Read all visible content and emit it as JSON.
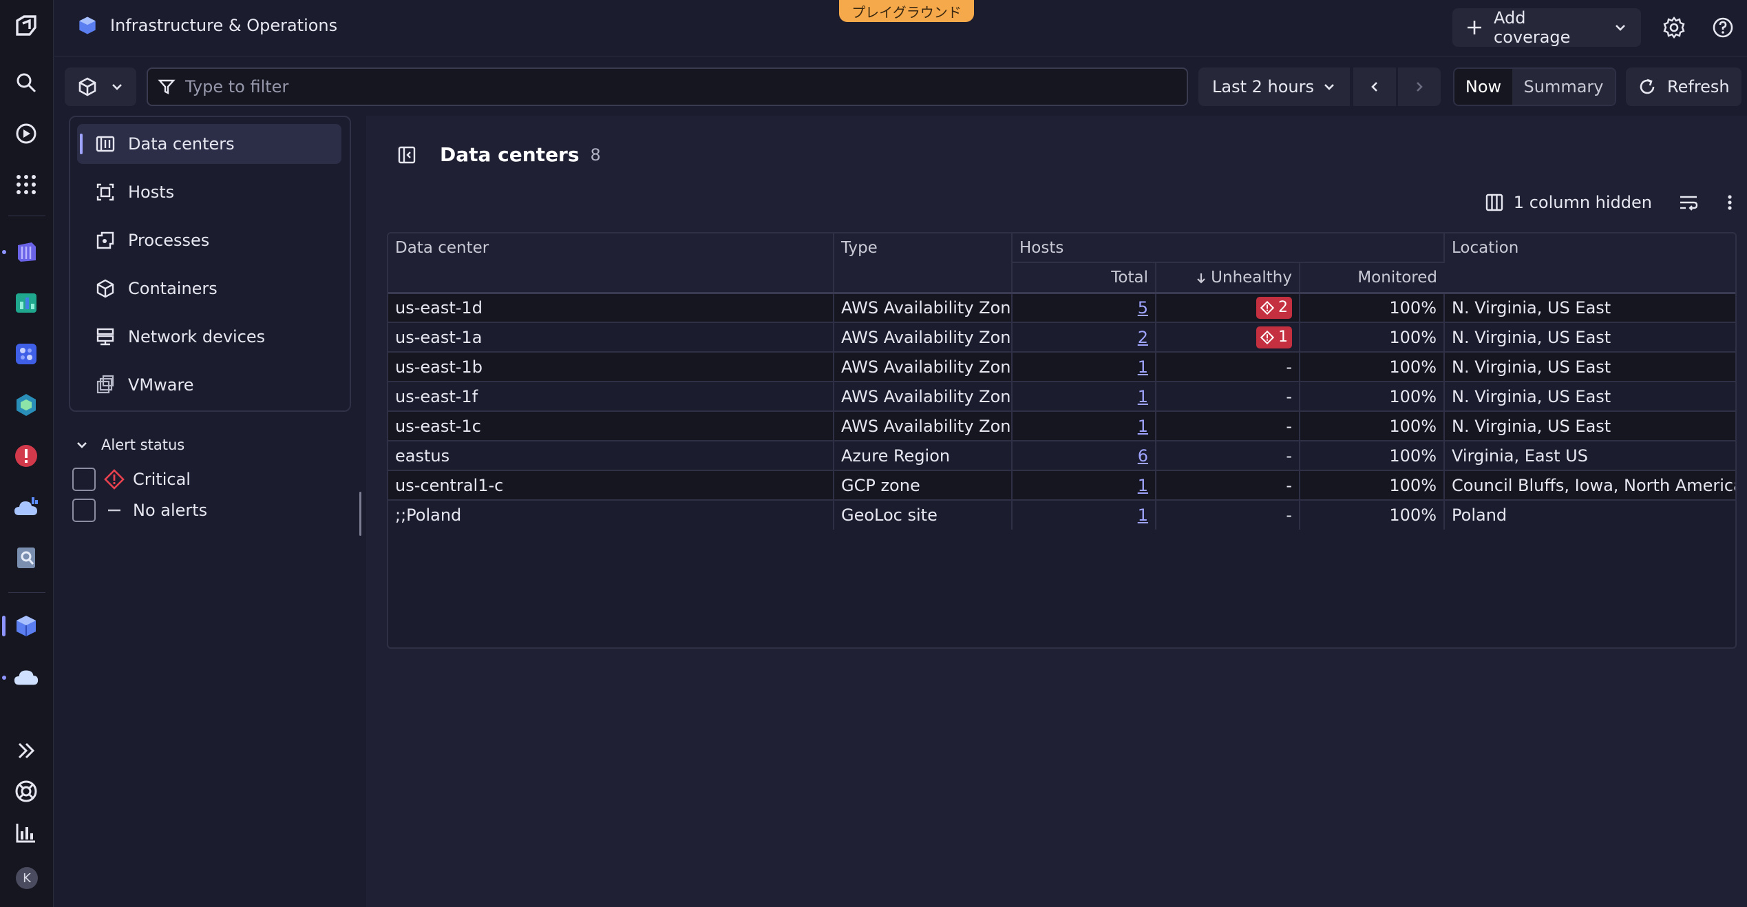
{
  "header": {
    "app_title": "Infrastructure & Operations",
    "playground_badge": "プレイグラウンド",
    "add_coverage_label": "Add coverage"
  },
  "toolbar": {
    "filter_placeholder": "Type to filter",
    "filter_value": "",
    "timeframe_label": "Last 2 hours",
    "now_label": "Now",
    "summary_label": "Summary",
    "refresh_label": "Refresh"
  },
  "nav": {
    "items": [
      {
        "label": "Data centers",
        "icon": "datacenter-icon",
        "active": true
      },
      {
        "label": "Hosts",
        "icon": "host-icon",
        "active": false
      },
      {
        "label": "Processes",
        "icon": "process-icon",
        "active": false
      },
      {
        "label": "Containers",
        "icon": "container-icon",
        "active": false
      },
      {
        "label": "Network devices",
        "icon": "network-device-icon",
        "active": false
      },
      {
        "label": "VMware",
        "icon": "vmware-icon",
        "active": false
      }
    ]
  },
  "alert_filter": {
    "heading": "Alert status",
    "options": [
      {
        "label": "Critical",
        "checked": false
      },
      {
        "label": "No alerts",
        "checked": false
      }
    ]
  },
  "main": {
    "title": "Data centers",
    "count": "8",
    "columns_hidden_label": "1 column hidden"
  },
  "table": {
    "headers": {
      "data_center": "Data center",
      "type": "Type",
      "hosts": "Hosts",
      "total": "Total",
      "unhealthy": "Unhealthy",
      "monitored": "Monitored",
      "location": "Location"
    },
    "rows": [
      {
        "data_center": "us-east-1d",
        "type": "AWS Availability Zone",
        "total": "5",
        "unhealthy": "2",
        "monitored": "100%",
        "location": "N. Virginia, US East"
      },
      {
        "data_center": "us-east-1a",
        "type": "AWS Availability Zone",
        "total": "2",
        "unhealthy": "1",
        "monitored": "100%",
        "location": "N. Virginia, US East"
      },
      {
        "data_center": "us-east-1b",
        "type": "AWS Availability Zone",
        "total": "1",
        "unhealthy": "-",
        "monitored": "100%",
        "location": "N. Virginia, US East"
      },
      {
        "data_center": "us-east-1f",
        "type": "AWS Availability Zone",
        "total": "1",
        "unhealthy": "-",
        "monitored": "100%",
        "location": "N. Virginia, US East"
      },
      {
        "data_center": "us-east-1c",
        "type": "AWS Availability Zone",
        "total": "1",
        "unhealthy": "-",
        "monitored": "100%",
        "location": "N. Virginia, US East"
      },
      {
        "data_center": "eastus",
        "type": "Azure Region",
        "total": "6",
        "unhealthy": "-",
        "monitored": "100%",
        "location": "Virginia, East US"
      },
      {
        "data_center": "us-central1-c",
        "type": "GCP zone",
        "total": "1",
        "unhealthy": "-",
        "monitored": "100%",
        "location": "Council Bluffs, Iowa, North America"
      },
      {
        "data_center": ";;Poland",
        "type": "GeoLoc site",
        "total": "1",
        "unhealthy": "-",
        "monitored": "100%",
        "location": "Poland"
      }
    ]
  },
  "rail": {
    "avatar_initial": "K"
  },
  "colors": {
    "accent": "#9ea4ff",
    "critical": "#c4303f",
    "playground": "#f5a94b",
    "background": "#1b1c2e"
  }
}
